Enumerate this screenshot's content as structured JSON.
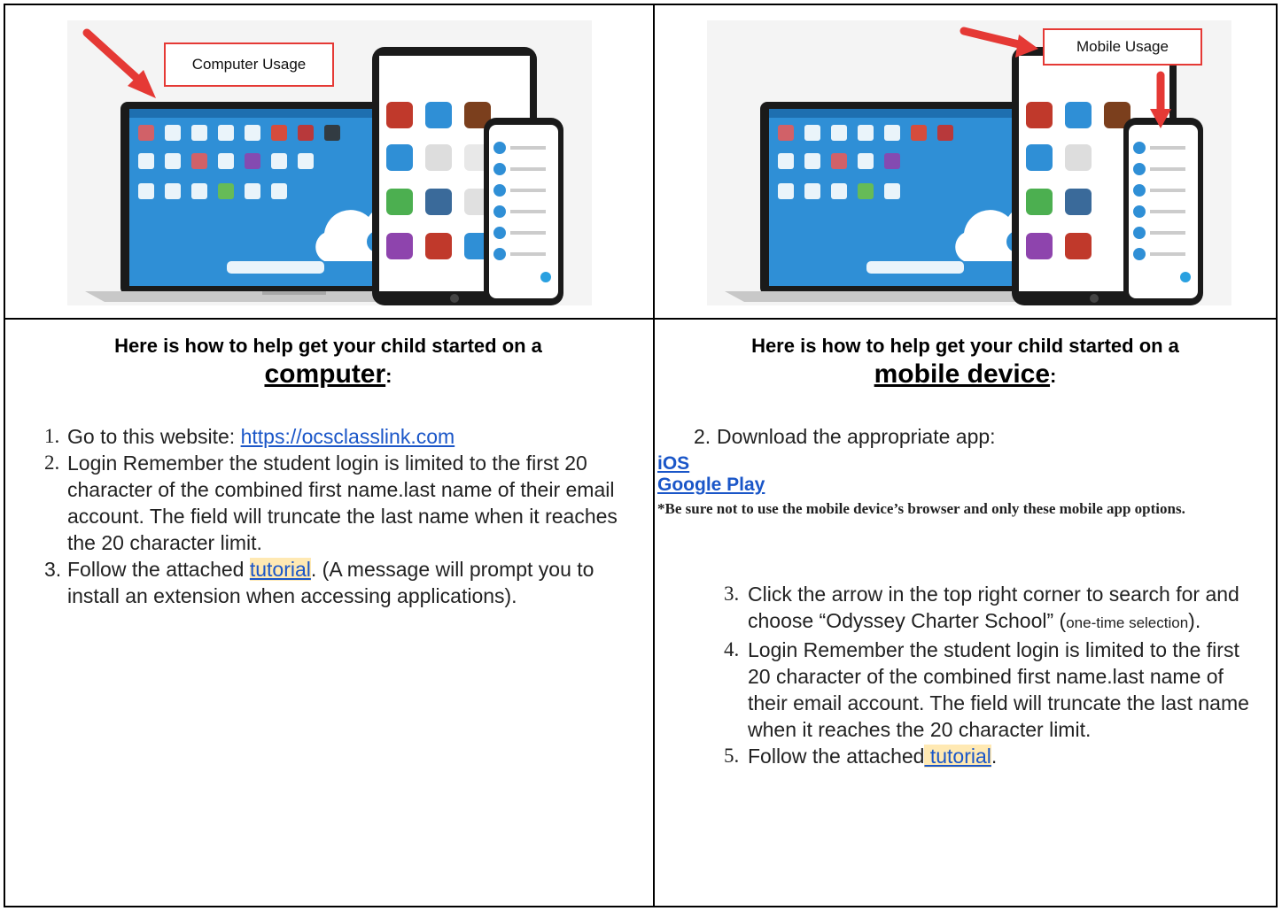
{
  "colors": {
    "link": "#1a56c8",
    "highlight": "#ffe9b3",
    "arrow": "#e53935",
    "screen_blue": "#2f8fd6"
  },
  "left": {
    "callout": "Computer Usage",
    "heading_line1": "Here is how to help get your child started on a",
    "heading_word": "computer",
    "heading_colon": ":",
    "steps": [
      {
        "num": "1.",
        "text": "Go to this website: ",
        "link": "https://ocsclasslink.com"
      },
      {
        "num": "2.",
        "text": "Login Remember the student login is limited to the first 20 character of the combined first name.last name of their email account. The field will truncate the last name when it reaches the 20 character limit."
      },
      {
        "num": "3.",
        "pre": "Follow the attached ",
        "link": "tutorial",
        "post": ". (A message will prompt you to install an extension when accessing applications)."
      }
    ]
  },
  "right": {
    "callout": "Mobile Usage",
    "heading_line1": "Here is how to help get your child started on a",
    "heading_word": "mobile device",
    "heading_colon": ":",
    "step2": {
      "num": "2.",
      "text": "Download the appropriate app:"
    },
    "app_links": [
      "iOS ",
      "Google Play"
    ],
    "note": "*Be sure not to use the mobile device’s browser and only these mobile app options.",
    "step3": {
      "num": "3.",
      "text": "Click the arrow in the top right corner to search for and choose “Odyssey Charter School” (",
      "small": "one-time selection",
      "end": ")."
    },
    "step4": {
      "num": "4.",
      "text": "Login Remember the student login is limited to the first 20 character of the combined first name.last name of their email account. The field will truncate the last name when it reaches the 20 character limit."
    },
    "step5": {
      "num": "5.",
      "pre": "Follow the attached",
      "link": " tutorial",
      "post": "."
    }
  },
  "icons": [
    "laptop-icon",
    "tablet-icon",
    "phone-icon",
    "red-arrow-icon",
    "cloud-logo-icon"
  ]
}
